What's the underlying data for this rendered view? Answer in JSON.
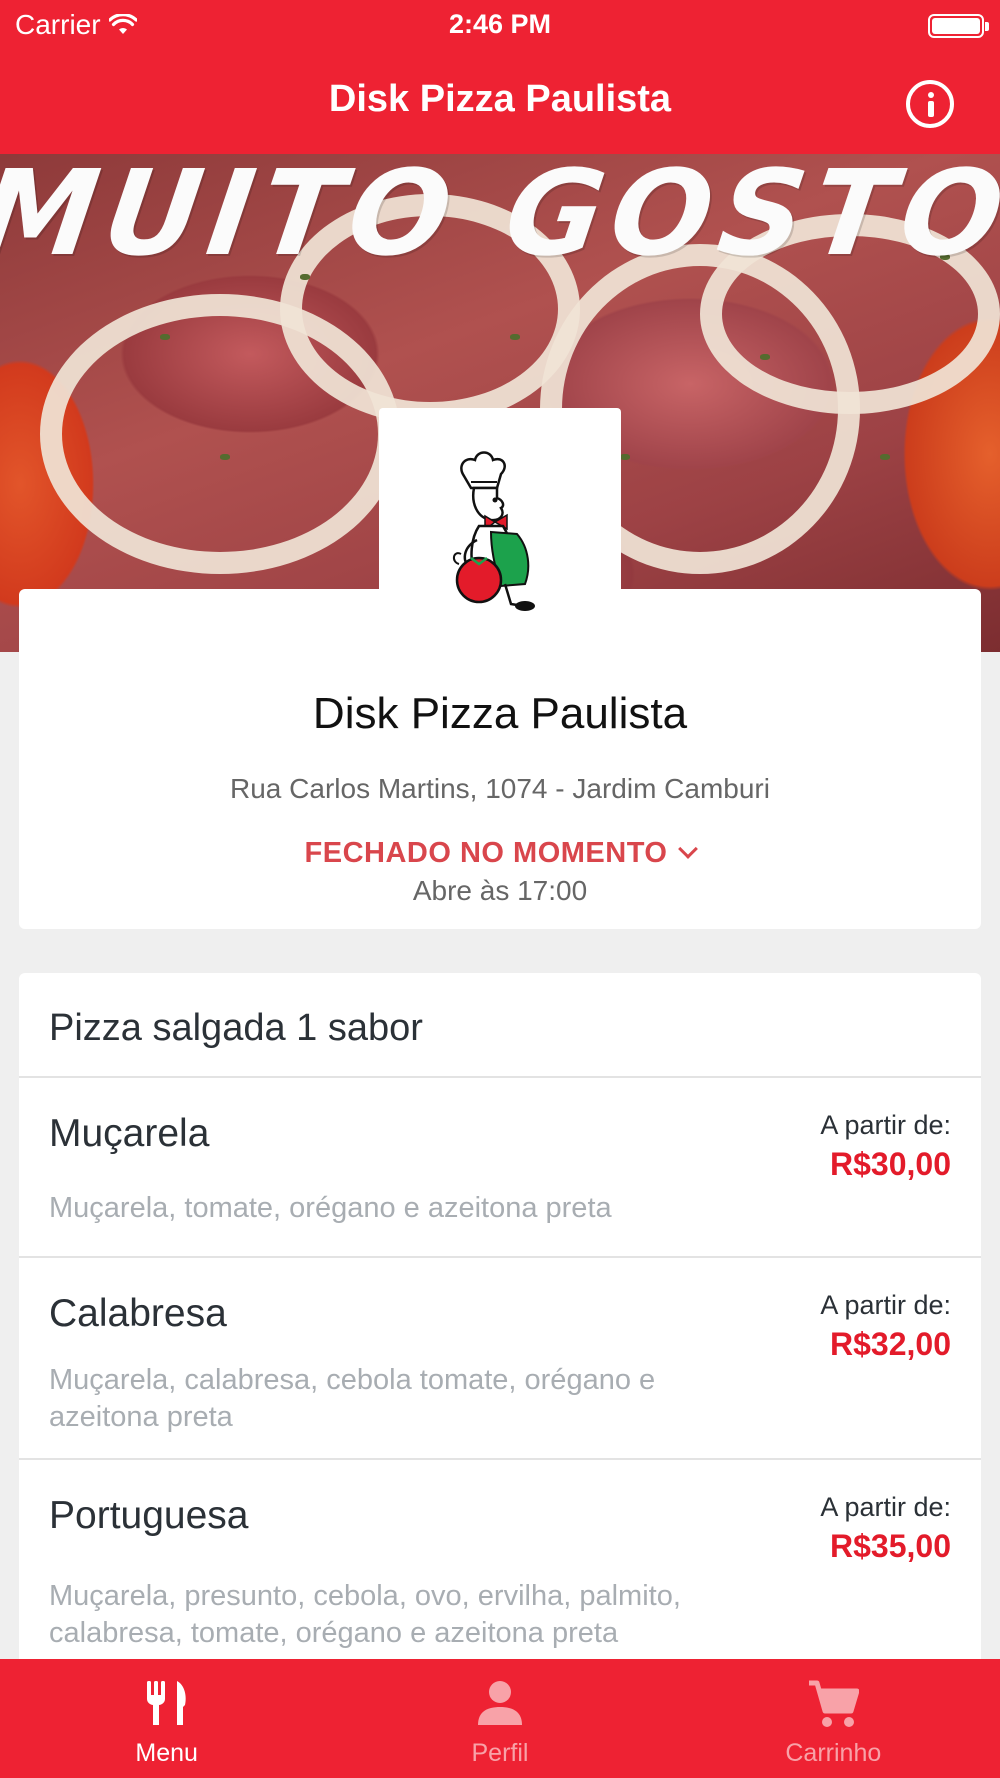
{
  "status_bar": {
    "carrier": "Carrier",
    "time": "2:46 PM"
  },
  "nav": {
    "title": "Disk Pizza Paulista"
  },
  "hero": {
    "headline": "MUITO GOSTOSO M"
  },
  "restaurant": {
    "name": "Disk Pizza Paulista",
    "address": "Rua Carlos Martins, 1074 - Jardim Camburi",
    "status": "FECHADO NO MOMENTO",
    "opens": "Abre às 17:00"
  },
  "menu": {
    "section_title": "Pizza salgada 1 sabor",
    "items": [
      {
        "name": "Muçarela",
        "description": "Muçarela, tomate, orégano e azeitona preta",
        "price_label": "A partir de:",
        "price": "R$30,00"
      },
      {
        "name": "Calabresa",
        "description": "Muçarela, calabresa, cebola tomate, orégano e azeitona preta",
        "price_label": "A partir de:",
        "price": "R$32,00"
      },
      {
        "name": "Portuguesa",
        "description": "Muçarela, presunto, cebola, ovo, ervilha, palmito, calabresa, tomate, orégano e azeitona preta",
        "price_label": "A partir de:",
        "price": "R$35,00"
      }
    ]
  },
  "tabs": [
    {
      "label": "Menu",
      "icon": "fork-knife-icon",
      "active": true
    },
    {
      "label": "Perfil",
      "icon": "person-icon",
      "active": false
    },
    {
      "label": "Carrinho",
      "icon": "cart-icon",
      "active": false
    }
  ],
  "colors": {
    "brand_red": "#ee2233",
    "price_red": "#e31b2a",
    "status_red": "#d9464c"
  }
}
